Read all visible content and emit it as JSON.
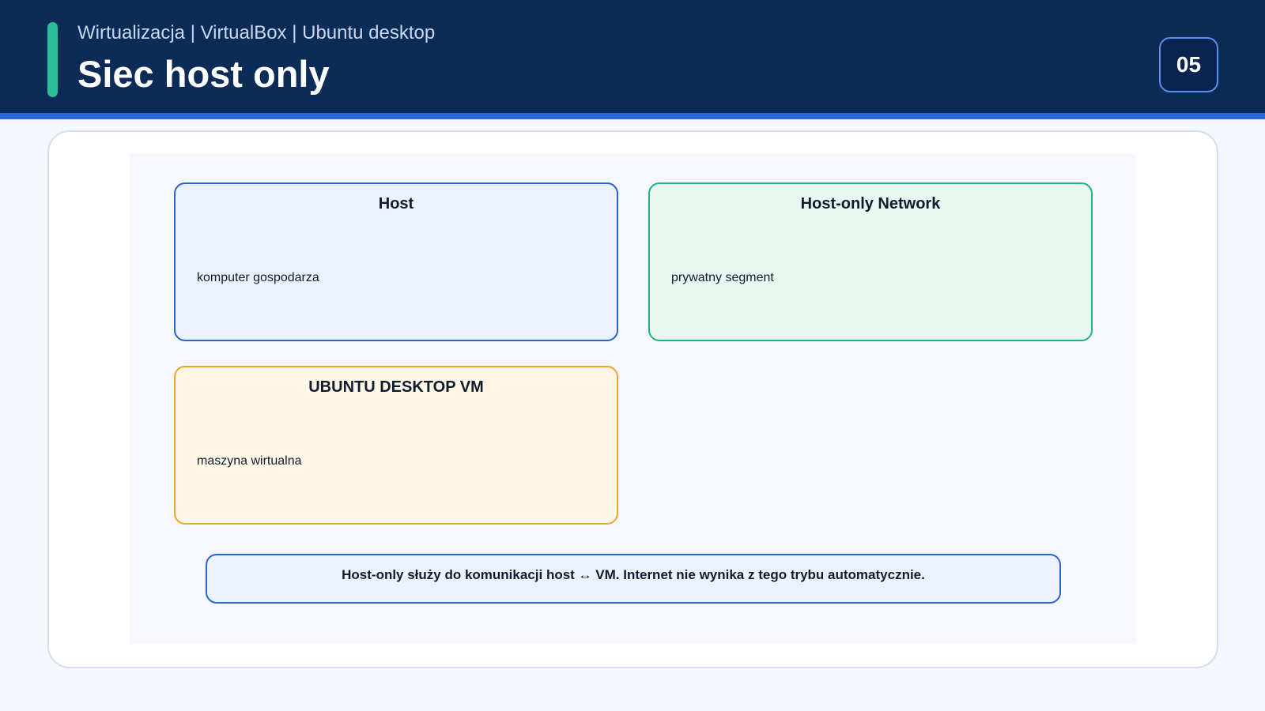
{
  "header": {
    "subtitle": "Wirtualizacja | VirtualBox | Ubuntu desktop",
    "title": "Siec host only",
    "page_number": "05"
  },
  "diagram": {
    "nodes": [
      {
        "title": "Host",
        "description": "komputer gospodarza",
        "color": "#2a63d0"
      },
      {
        "title": "Host-only Network",
        "description": "prywatny segment",
        "color": "#1fb386"
      },
      {
        "title": "UBUNTU DESKTOP VM",
        "description": "maszyna wirtualna",
        "color": "#f0a42e"
      }
    ],
    "note": "Host-only służy do komunikacji host ↔ VM. Internet nie wynika z tego trybu automatycznie."
  },
  "colors": {
    "header_bg": "#0d2b57",
    "accent": "#2bbf98",
    "stripe": "#2a6ad8"
  }
}
